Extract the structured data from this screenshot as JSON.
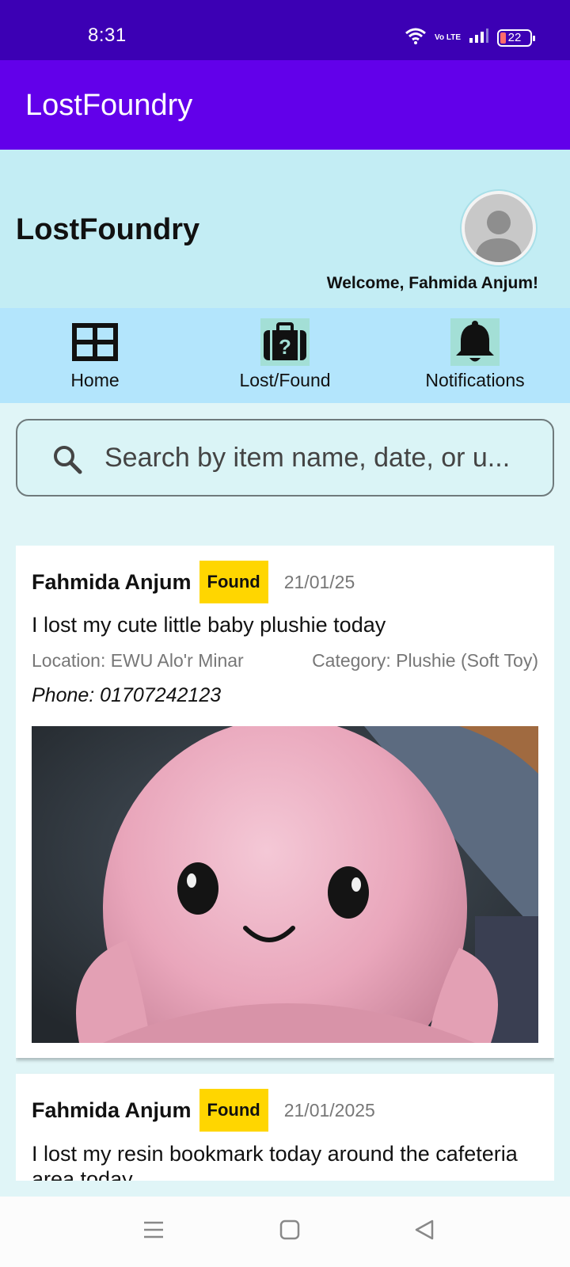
{
  "status_bar": {
    "time": "8:31",
    "network": "Vo LTE",
    "battery": "22",
    "icons": [
      "wifi-icon",
      "signal-icon",
      "battery-icon"
    ]
  },
  "app_bar": {
    "title": "LostFoundry"
  },
  "header": {
    "title": "LostFoundry",
    "welcome": "Welcome, Fahmida Anjum!",
    "avatar_icon": "user-avatar-icon"
  },
  "nav": {
    "items": [
      {
        "label": "Home",
        "icon": "grid-icon"
      },
      {
        "label": "Lost/Found",
        "icon": "suitcase-question-icon"
      },
      {
        "label": "Notifications",
        "icon": "bell-icon"
      }
    ]
  },
  "search": {
    "placeholder": "Search by item name, date, or u...",
    "icon": "search-icon"
  },
  "posts": [
    {
      "author": "Fahmida Anjum",
      "status": "Found",
      "date": "21/01/25",
      "description": "I lost my cute little baby plushie today",
      "location": "Location: EWU Alo'r Minar",
      "category": "Category: Plushie (Soft Toy)",
      "phone": "Phone: 01707242123"
    },
    {
      "author": "Fahmida Anjum",
      "status": "Found",
      "date": "21/01/2025",
      "description": "I lost my resin bookmark today around the cafeteria area today"
    }
  ],
  "colors": {
    "status_bar": "#3c00b4",
    "app_bar": "#6200ea",
    "header_bg": "#c3edf4",
    "nav_bg": "#b3e5fc",
    "badge": "#ffd600",
    "page_bg": "#e0f5f7"
  },
  "system_nav": {
    "icons": [
      "menu-icon",
      "home-square-icon",
      "back-triangle-icon"
    ]
  }
}
